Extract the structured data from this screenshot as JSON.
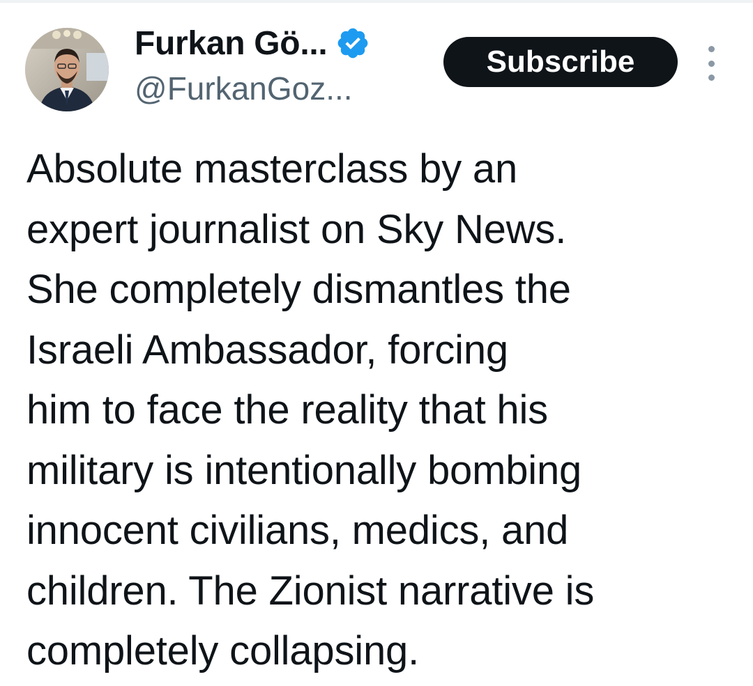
{
  "author": {
    "display_name": "Furkan Gö...",
    "handle": "@FurkanGoz...",
    "verified_icon": "verified-badge-icon",
    "verified_color": "#1d9bf0",
    "avatar": "avatar-photo"
  },
  "actions": {
    "subscribe_label": "Subscribe",
    "more_icon": "more-vertical-icon"
  },
  "tweet": {
    "lines": [
      "Absolute masterclass by an",
      "expert journalist on Sky News.",
      "She completely dismantles the",
      "Israeli Ambassador, forcing",
      "him to face the reality that his",
      "military is intentionally bombing",
      "innocent civilians, medics, and",
      "children. The Zionist narrative is",
      "completely collapsing."
    ]
  },
  "colors": {
    "text": "#0f1419",
    "secondary_text": "#536471",
    "button_bg": "#0f1419",
    "button_text": "#ffffff"
  }
}
